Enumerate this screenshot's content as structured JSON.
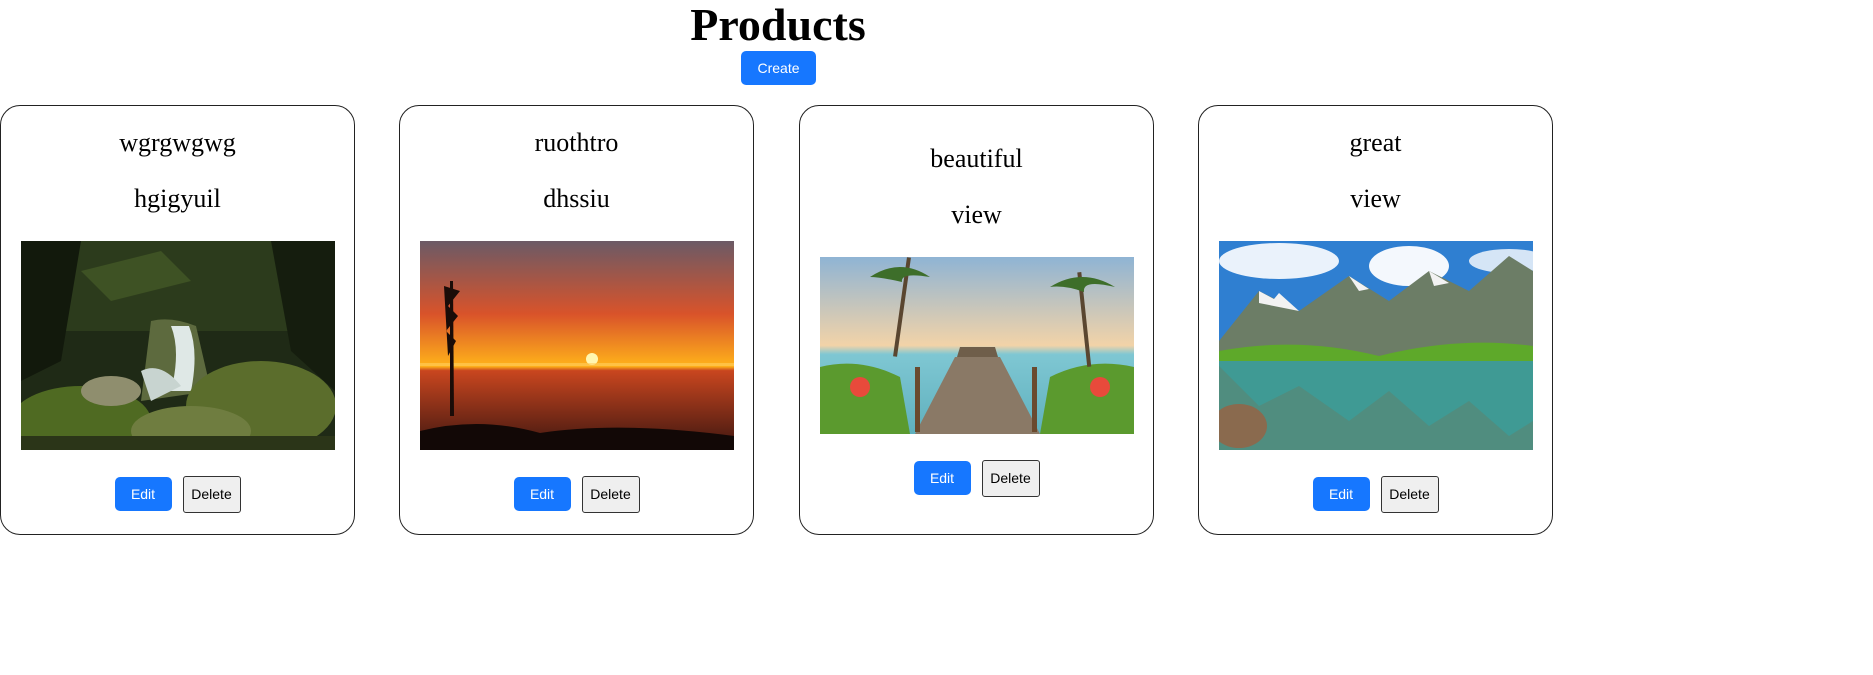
{
  "header": {
    "title": "Products",
    "create_label": "Create"
  },
  "products": [
    {
      "title": "wgrgwgwg",
      "description": "hgigyuil",
      "image": "waterfall-in-forest",
      "edit_label": "Edit",
      "delete_label": "Delete"
    },
    {
      "title": "ruothtro",
      "description": "dhssiu",
      "image": "sunset-over-sea",
      "edit_label": "Edit",
      "delete_label": "Delete"
    },
    {
      "title": "beautiful",
      "description": "view",
      "image": "boardwalk-to-beach",
      "edit_label": "Edit",
      "delete_label": "Delete"
    },
    {
      "title": "great",
      "description": "view",
      "image": "mountain-lake",
      "edit_label": "Edit",
      "delete_label": "Delete"
    }
  ],
  "colors": {
    "primary": "#1677ff",
    "delete_bg": "#efefef",
    "border": "#222222"
  }
}
